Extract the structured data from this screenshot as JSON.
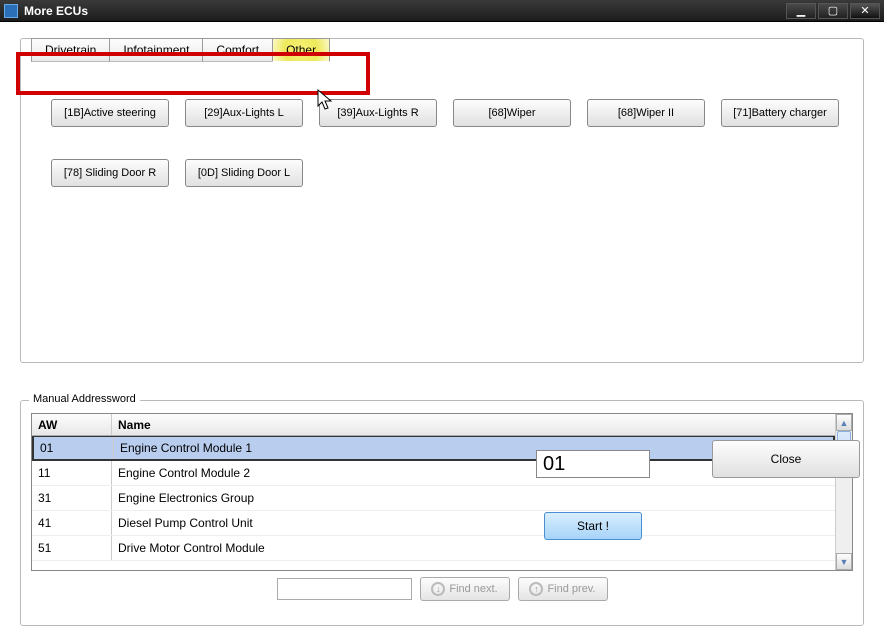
{
  "window": {
    "title": "More ECUs"
  },
  "tabs": {
    "items": [
      {
        "label": "Drivetrain"
      },
      {
        "label": "Infotainment"
      },
      {
        "label": "Comfort"
      },
      {
        "label": "Other"
      }
    ],
    "active_index": 3
  },
  "ecus_row1": [
    {
      "label": "[1B]Active steering"
    },
    {
      "label": "[29]Aux-Lights L"
    },
    {
      "label": "[39]Aux-Lights R"
    },
    {
      "label": "[68]Wiper"
    },
    {
      "label": "[68]Wiper II"
    },
    {
      "label": "[71]Battery charger"
    }
  ],
  "ecus_row2": [
    {
      "label": "[78] Sliding Door R"
    },
    {
      "label": "[0D] Sliding Door L"
    }
  ],
  "manual": {
    "legend": "Manual Addressword",
    "headers": {
      "aw": "AW",
      "name": "Name"
    },
    "rows": [
      {
        "aw": "01",
        "name": "Engine Control Module 1"
      },
      {
        "aw": "11",
        "name": "Engine Control Module 2"
      },
      {
        "aw": "31",
        "name": "Engine Electronics Group"
      },
      {
        "aw": "41",
        "name": "Diesel Pump Control Unit"
      },
      {
        "aw": "51",
        "name": "Drive Motor Control Module"
      }
    ],
    "selected_index": 0,
    "find_next": "Find next.",
    "find_prev": "Find prev."
  },
  "address_value": "01",
  "buttons": {
    "start": "Start !",
    "close": "Close"
  }
}
